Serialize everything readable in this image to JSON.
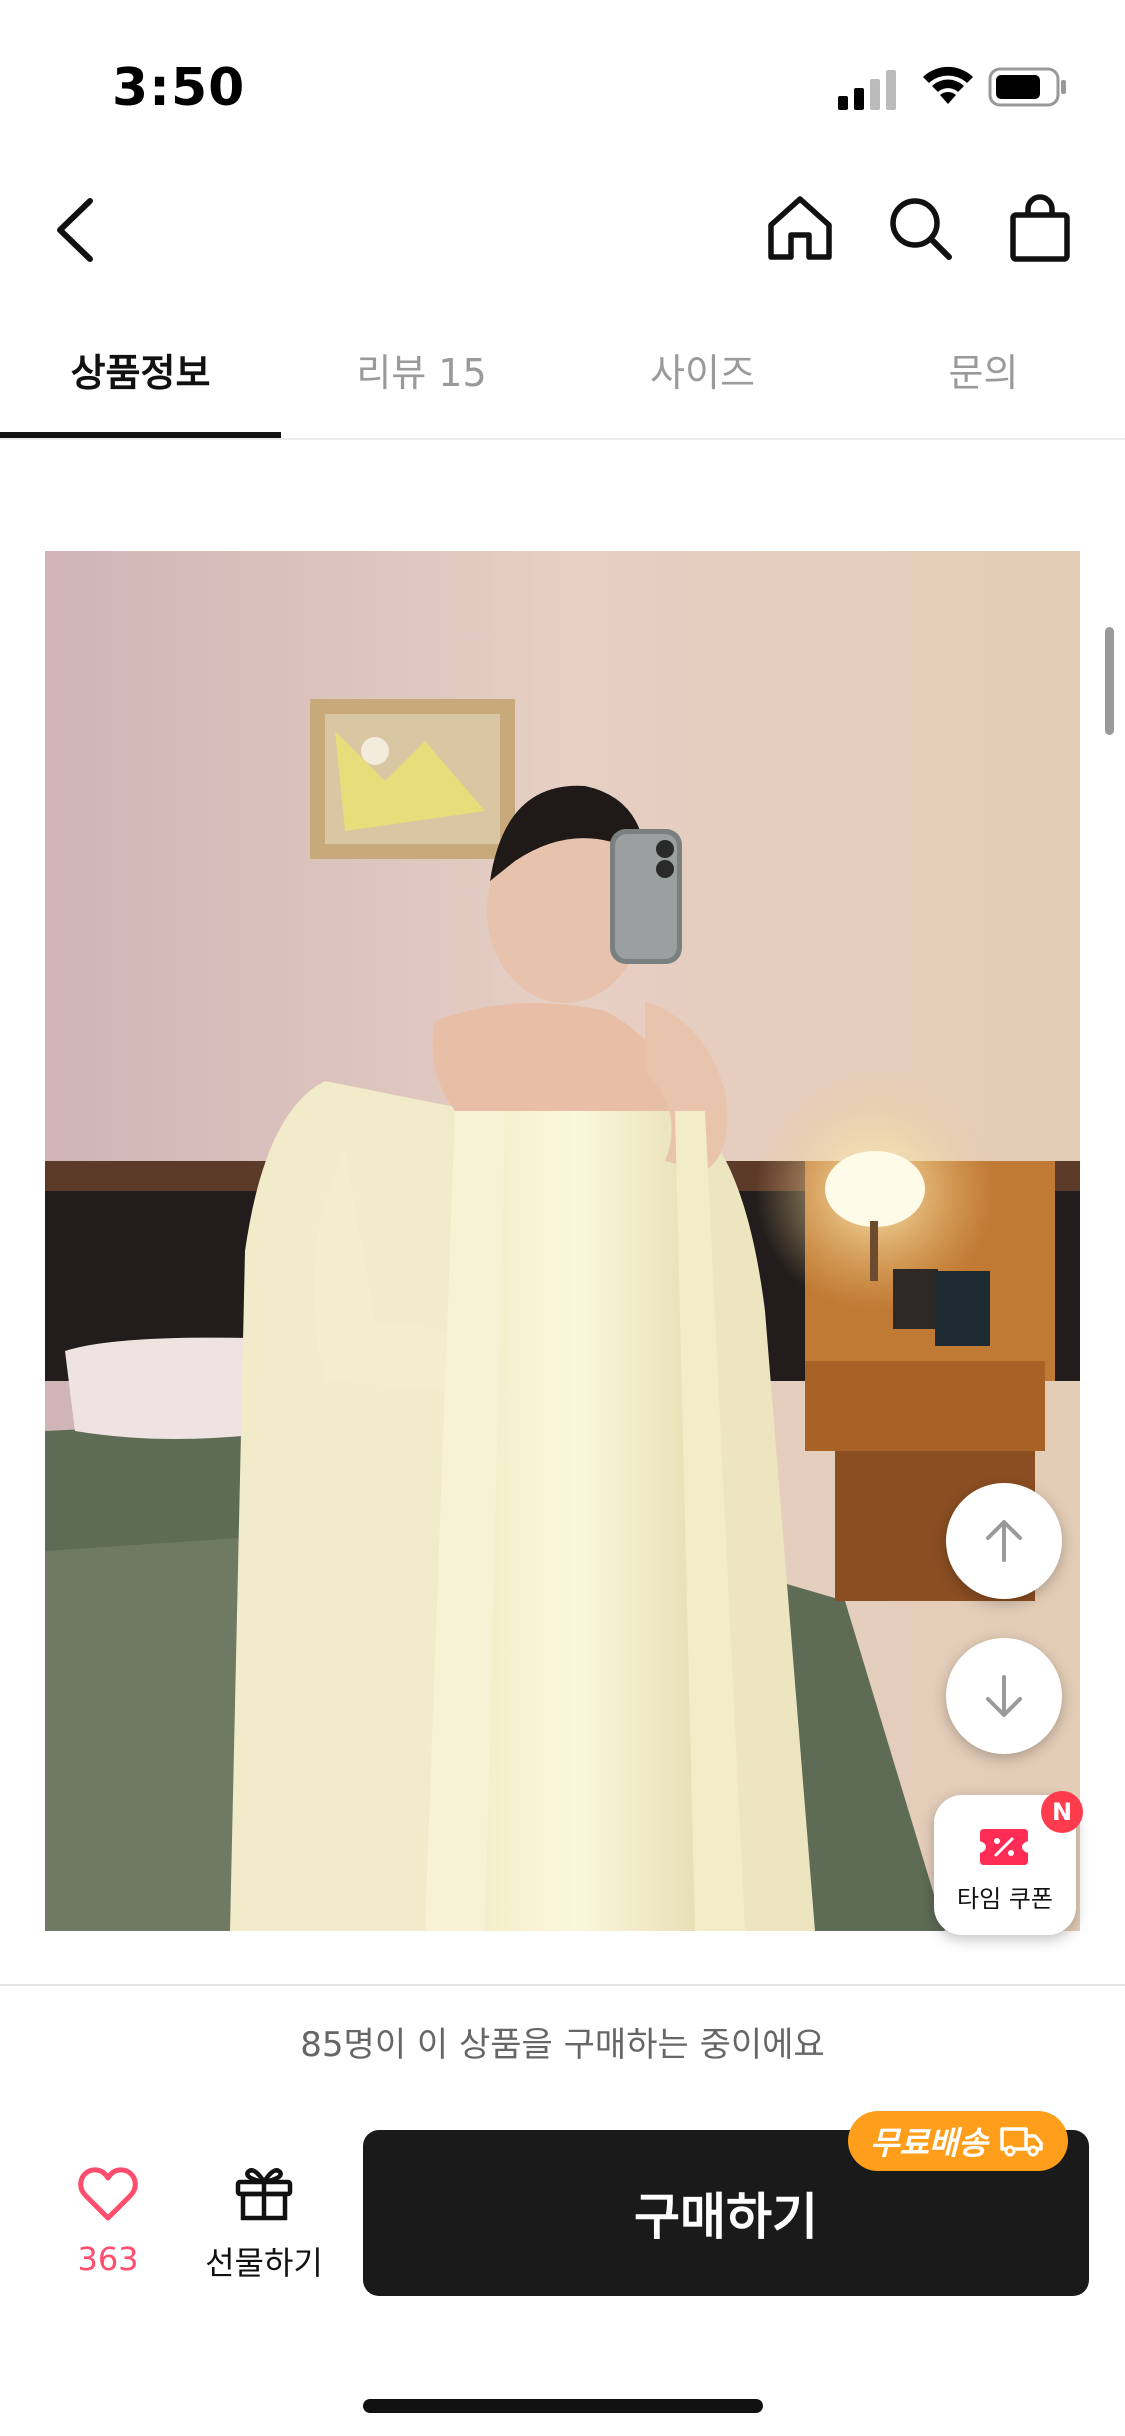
{
  "status_bar": {
    "time": "3:50"
  },
  "tabs": [
    {
      "label": "상품정보"
    },
    {
      "label": "리뷰 15"
    },
    {
      "label": "사이즈"
    },
    {
      "label": "문의"
    }
  ],
  "coupon": {
    "label": "타임 쿠폰",
    "badge": "N"
  },
  "buyers_notice": "85명이 이 상품을 구매하는 중이에요",
  "bottom_bar": {
    "like_count": "363",
    "gift_label": "선물하기",
    "buy_label": "구매하기",
    "free_shipping_label": "무료배송"
  },
  "colors": {
    "accent_like": "#ff4d6d",
    "buy_button": "#1a1a1a",
    "free_shipping": "#ff9e1b",
    "coupon_badge": "#ff3b4e"
  }
}
